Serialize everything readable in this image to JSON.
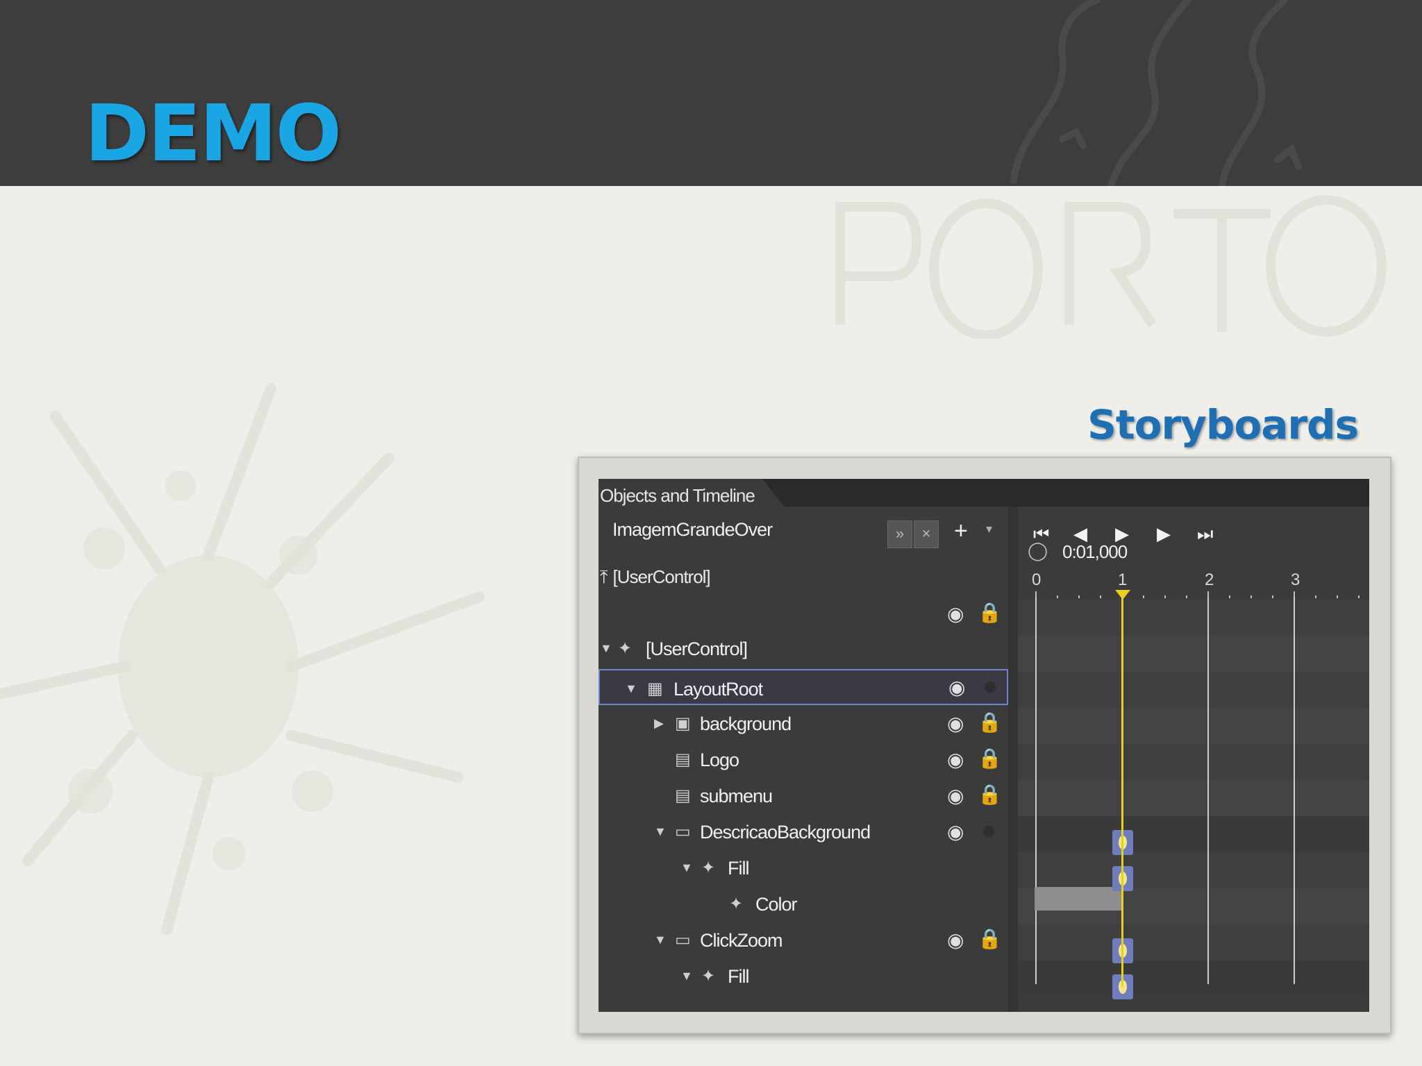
{
  "slide": {
    "title": "DEMO",
    "subtitle": "Storyboards"
  },
  "panel": {
    "title": "Objects and Timeline",
    "storyboard_name": "ImagemGrandeOver",
    "scope_label": "[UserControl]",
    "time_display": "0:01,000",
    "ruler_ticks": [
      "0",
      "1",
      "2",
      "3"
    ],
    "tree": [
      {
        "label": "[UserControl]",
        "icon": "usercontrol-icon"
      },
      {
        "label": "LayoutRoot",
        "icon": "grid-icon",
        "selected": true
      },
      {
        "label": "background",
        "icon": "canvas-icon"
      },
      {
        "label": "Logo",
        "icon": "textblock-icon"
      },
      {
        "label": "submenu",
        "icon": "panel-icon"
      },
      {
        "label": "DescricaoBackground",
        "icon": "rectangle-icon"
      },
      {
        "label": "Fill",
        "icon": "brush-icon"
      },
      {
        "label": "Color",
        "icon": "brush-icon"
      },
      {
        "label": "ClickZoom",
        "icon": "rectangle-icon"
      },
      {
        "label": "Fill",
        "icon": "brush-icon"
      }
    ]
  },
  "colors": {
    "title": "#1aa5e4",
    "subtitle": "#1e6fb4",
    "header_bg": "#3d3d3d",
    "playhead": "#e6d21c",
    "selection": "#6b86c9"
  }
}
